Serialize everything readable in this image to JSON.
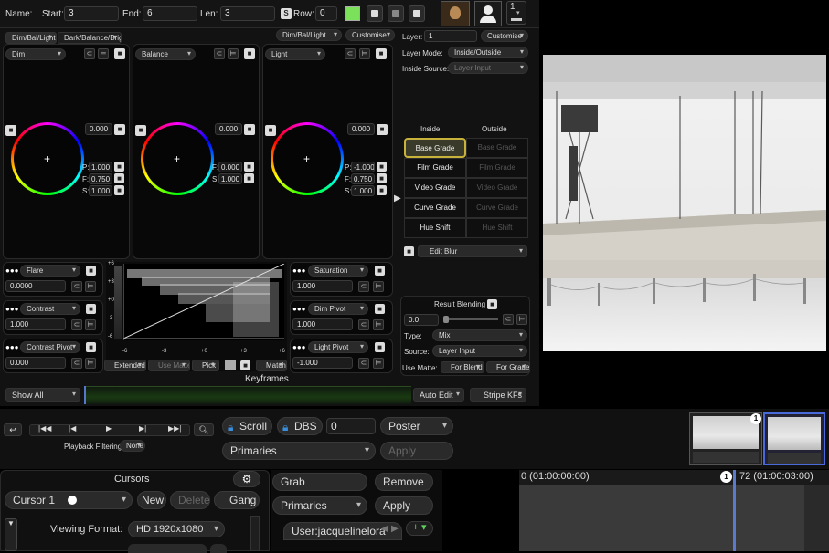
{
  "top": {
    "name_label": "Name:",
    "start_label": "Start:",
    "start_value": "3",
    "end_label": "End:",
    "end_value": "6",
    "len_label": "Len:",
    "len_value": "3",
    "s_label": "S",
    "row_label": "Row:",
    "row_value": "0",
    "layer_number": "1",
    "accent_color": "#7be05a"
  },
  "tabs": {
    "preset1": "Dim/Bal/Light",
    "preset2": "Dark/Balance/Bright",
    "selector": "Dim/Bal/Light",
    "customise": "Customise"
  },
  "wheels": [
    {
      "name": "Dim",
      "value": "0.000",
      "p": "1.000",
      "f": "0.750",
      "s": "1.000"
    },
    {
      "name": "Balance",
      "value": "0.000",
      "f": "0.000",
      "s": "1.000"
    },
    {
      "name": "Light",
      "value": "0.000",
      "p": "-1.000",
      "f": "0.750",
      "s": "1.000"
    }
  ],
  "wheel_labels": {
    "p": "P:",
    "f": "F:",
    "s": "S:"
  },
  "left_params": [
    {
      "name": "Flare",
      "value": "0.0000"
    },
    {
      "name": "Contrast",
      "value": "1.000"
    },
    {
      "name": "Contrast Pivot",
      "value": "0.000"
    }
  ],
  "right_params": [
    {
      "name": "Saturation",
      "value": "1.000"
    },
    {
      "name": "Dim Pivot",
      "value": "1.000"
    },
    {
      "name": "Light Pivot",
      "value": "-1.000"
    }
  ],
  "histogram": {
    "y_ticks": [
      "+6",
      "+3",
      "+0",
      "-3",
      "-6"
    ],
    "x_ticks": [
      "-6",
      "-3",
      "+0",
      "+3",
      "+6"
    ],
    "extended": "Extended",
    "use_matte": "Use Matte",
    "pick": "Pick",
    "match": "Match"
  },
  "layer_panel": {
    "layer_label": "Layer:",
    "layer_value": "1",
    "customise": "Customise",
    "mode_label": "Layer Mode:",
    "mode_value": "Inside/Outside",
    "source_label": "Inside Source:",
    "source_value": "Layer Input",
    "inside": "Inside",
    "outside": "Outside",
    "grades": [
      "Base Grade",
      "Film Grade",
      "Video Grade",
      "Curve Grade",
      "Hue Shift"
    ],
    "edit_blur": "Edit Blur",
    "result_blending": "Result Blending",
    "blend_value": "0.0",
    "type_label": "Type:",
    "type_value": "Mix",
    "src_label": "Source:",
    "src_value": "Layer Input",
    "use_matte": "Use Matte:",
    "for_blend": "For Blend",
    "for_grade": "For Grade"
  },
  "keyframes": {
    "title": "Keyframes",
    "show": "Show All",
    "auto_edit": "Auto Edit",
    "stripe": "Stripe KFs"
  },
  "transport": {
    "playback_filtering": "Playback Filtering:",
    "filtering_value": "None",
    "scroll": "Scroll",
    "dbs": "DBS",
    "dbs_value": "0",
    "poster": "Poster",
    "primaries": "Primaries",
    "apply": "Apply"
  },
  "cursors": {
    "title": "Cursors",
    "cursor": "Cursor 1",
    "new": "New",
    "delete": "Delete",
    "gang": "Gang",
    "viewing_format_label": "Viewing Format:",
    "viewing_format": "HD 1920x1080"
  },
  "actions": {
    "grab": "Grab",
    "remove": "Remove",
    "primaries": "Primaries",
    "apply": "Apply",
    "user": "User:jacquelinelora"
  },
  "timeline": {
    "start": "0 (01:00:00:00)",
    "end": "72 (01:00:03:00)",
    "marker": "1",
    "thumb_badge": "1"
  }
}
